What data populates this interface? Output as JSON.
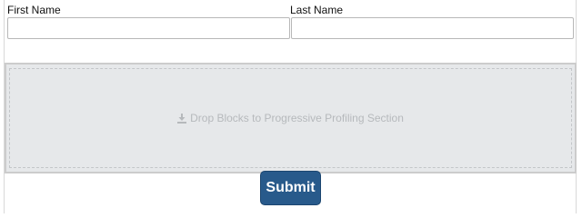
{
  "form": {
    "first_name": {
      "label": "First Name",
      "value": "",
      "placeholder": ""
    },
    "last_name": {
      "label": "Last Name",
      "value": "",
      "placeholder": ""
    },
    "drop_zone": {
      "message": "Drop Blocks to Progressive Profiling Section",
      "icon": "download-icon"
    },
    "submit_label": "Submit"
  },
  "colors": {
    "submit_button": "#285a8b",
    "drop_zone_background": "#e6e8ea",
    "drop_zone_text": "#b6b9bc"
  }
}
